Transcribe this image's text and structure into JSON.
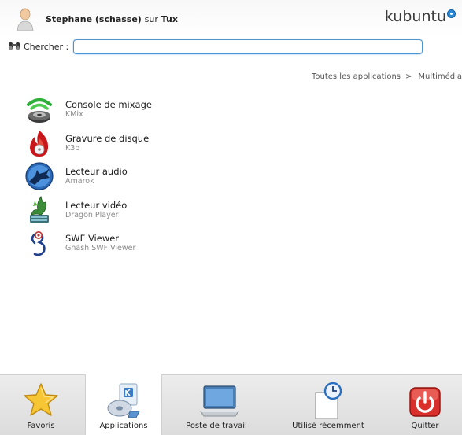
{
  "header": {
    "user_name": "Stephane (schasse)",
    "sur_text": "sur",
    "host": "Tux",
    "brand": "kubuntu"
  },
  "search": {
    "label": "Chercher :",
    "value": "",
    "placeholder": ""
  },
  "breadcrumb": {
    "items": [
      "Toutes les applications",
      "Multimédia"
    ],
    "separator": ">"
  },
  "apps": [
    {
      "name": "Console de mixage",
      "sub": "KMix",
      "icon": "kmix-speaker-icon"
    },
    {
      "name": "Gravure de disque",
      "sub": "K3b",
      "icon": "k3b-flame-icon"
    },
    {
      "name": "Lecteur audio",
      "sub": "Amarok",
      "icon": "amarok-wolf-icon"
    },
    {
      "name": "Lecteur vidéo",
      "sub": "Dragon Player",
      "icon": "dragon-player-icon"
    },
    {
      "name": "SWF Viewer",
      "sub": "Gnash SWF Viewer",
      "icon": "gnash-icon"
    }
  ],
  "tabs": [
    {
      "label": "Favoris",
      "icon": "star-icon",
      "active": false
    },
    {
      "label": "Applications",
      "icon": "applications-icon",
      "active": true
    },
    {
      "label": "Poste de travail",
      "icon": "computer-icon",
      "active": false
    },
    {
      "label": "Utilisé récemment",
      "icon": "recent-clock-icon",
      "active": false
    },
    {
      "label": "Quitter",
      "icon": "power-icon",
      "active": false
    }
  ],
  "colors": {
    "search_border": "#4c93d3",
    "brand_dot": "#2a8ad8",
    "quit_red": "#d9302b"
  }
}
